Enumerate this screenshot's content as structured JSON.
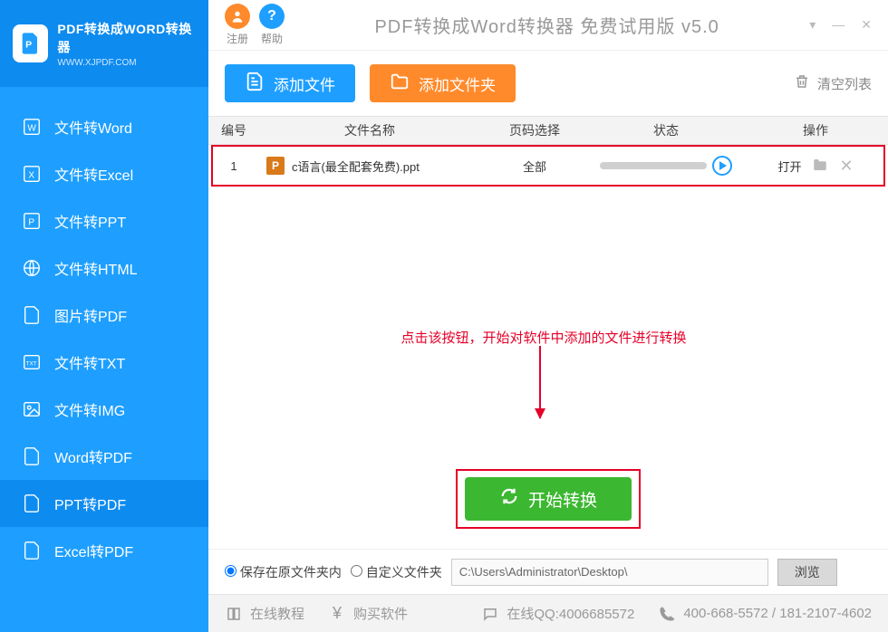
{
  "logo": {
    "title": "PDF转换成WORD转换器",
    "subtitle": "WWW.XJPDF.COM"
  },
  "sidebar": {
    "items": [
      {
        "label": "文件转Word"
      },
      {
        "label": "文件转Excel"
      },
      {
        "label": "文件转PPT"
      },
      {
        "label": "文件转HTML"
      },
      {
        "label": "图片转PDF"
      },
      {
        "label": "文件转TXT"
      },
      {
        "label": "文件转IMG"
      },
      {
        "label": "Word转PDF"
      },
      {
        "label": "PPT转PDF"
      },
      {
        "label": "Excel转PDF"
      }
    ],
    "activeIndex": 8
  },
  "titlebar": {
    "register": "注册",
    "help": "帮助",
    "title": "PDF转换成Word转换器 免费试用版 v5.0"
  },
  "toolbar": {
    "add_file": "添加文件",
    "add_folder": "添加文件夹",
    "clear_list": "清空列表"
  },
  "table": {
    "headers": {
      "num": "编号",
      "name": "文件名称",
      "page": "页码选择",
      "status": "状态",
      "op": "操作"
    },
    "rows": [
      {
        "num": "1",
        "name": "c语言(最全配套免费).ppt",
        "page": "全部",
        "open": "打开"
      }
    ]
  },
  "annotation": "点击该按钮，开始对软件中添加的文件进行转换",
  "convert_button": "开始转换",
  "save": {
    "opt_same": "保存在原文件夹内",
    "opt_custom": "自定义文件夹",
    "path": "C:\\Users\\Administrator\\Desktop\\",
    "browse": "浏览"
  },
  "footer": {
    "tutorial": "在线教程",
    "buy": "购买软件",
    "qq": "在线QQ:4006685572",
    "phone": "400-668-5572 / 181-2107-4602"
  }
}
